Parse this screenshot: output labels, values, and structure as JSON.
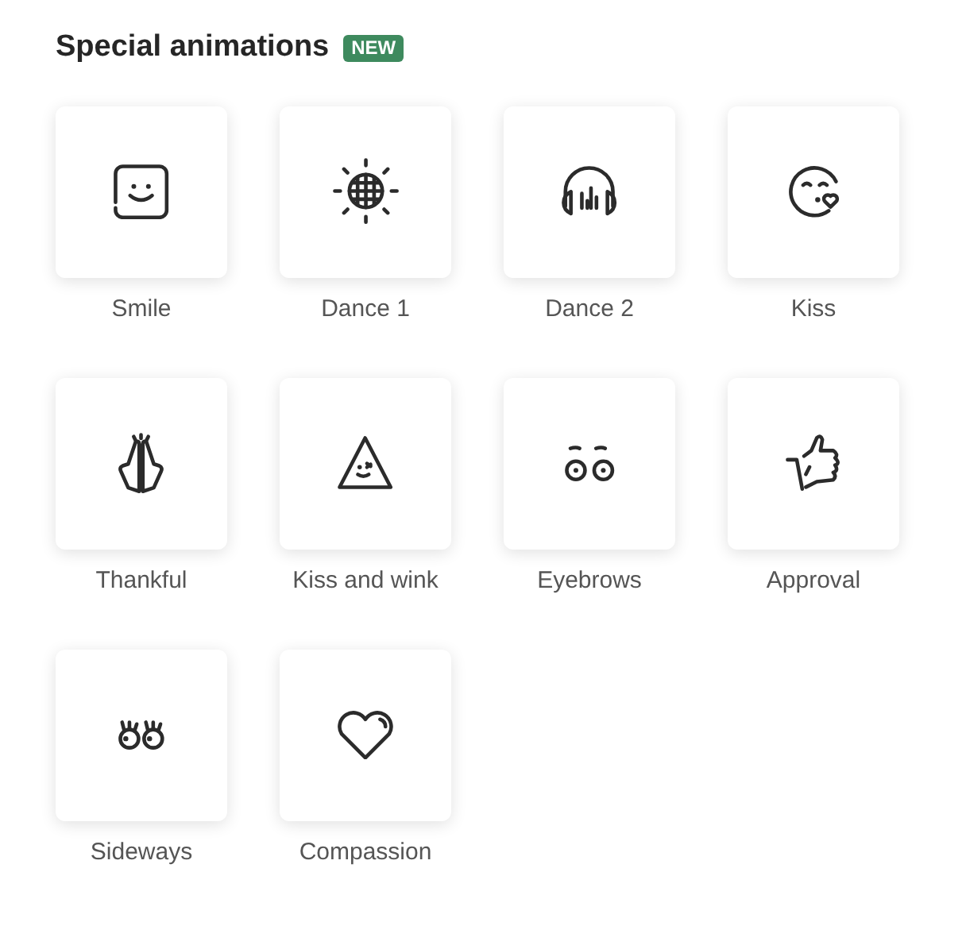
{
  "section": {
    "title": "Special animations",
    "badge": "NEW"
  },
  "animations": [
    {
      "label": "Smile",
      "kind": "smile"
    },
    {
      "label": "Dance 1",
      "kind": "disco"
    },
    {
      "label": "Dance 2",
      "kind": "headphones"
    },
    {
      "label": "Kiss",
      "kind": "kiss"
    },
    {
      "label": "Thankful",
      "kind": "pray"
    },
    {
      "label": "Kiss and wink",
      "kind": "triangle"
    },
    {
      "label": "Eyebrows",
      "kind": "eyebrows"
    },
    {
      "label": "Approval",
      "kind": "thumb"
    },
    {
      "label": "Sideways",
      "kind": "sideways"
    },
    {
      "label": "Compassion",
      "kind": "heart"
    }
  ]
}
